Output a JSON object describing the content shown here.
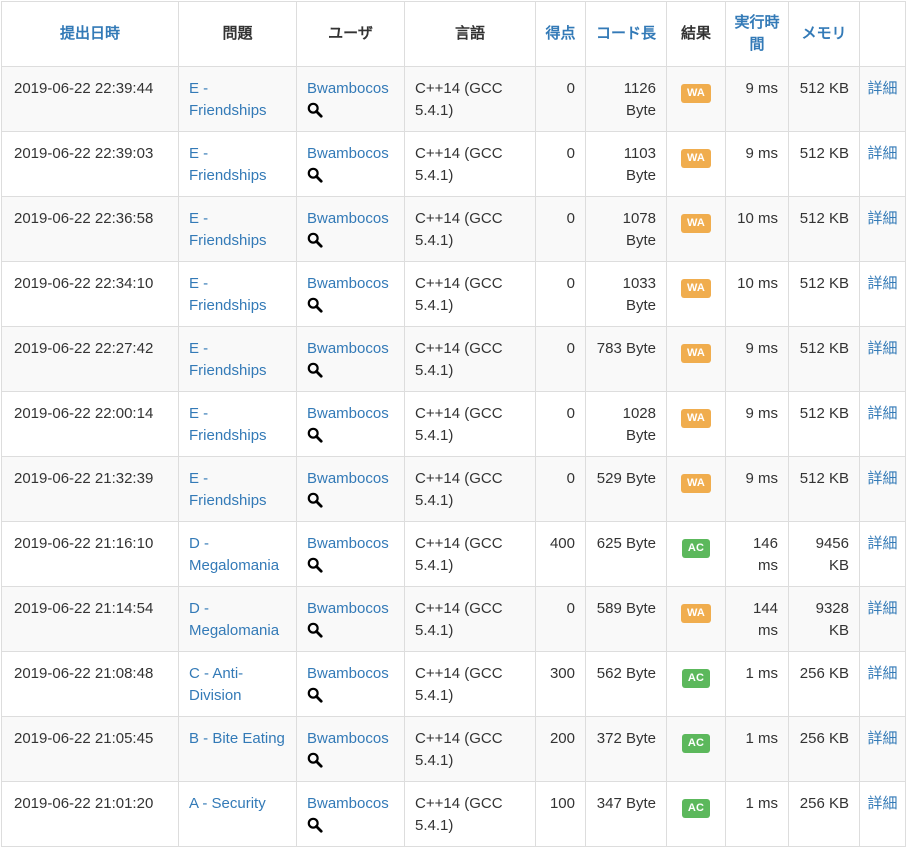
{
  "colors": {
    "link": "#337ab7",
    "wa": "#f0ad4e",
    "ac": "#5cb85c"
  },
  "headers": {
    "time": "提出日時",
    "problem": "問題",
    "user": "ユーザ",
    "language": "言語",
    "score": "得点",
    "code_length": "コード長",
    "result": "結果",
    "exec_time": "実行時間",
    "memory": "メモリ"
  },
  "icons": {
    "search": "magnifier-icon"
  },
  "rows": [
    {
      "time": "2019-06-22 22:39:44",
      "problem": "E - Friendships",
      "user": "Bwambocos",
      "lang": "C++14 (GCC 5.4.1)",
      "score": "0",
      "length": "1126 Byte",
      "result": "WA",
      "exec": "9 ms",
      "memory": "512 KB",
      "detail": "詳細"
    },
    {
      "time": "2019-06-22 22:39:03",
      "problem": "E - Friendships",
      "user": "Bwambocos",
      "lang": "C++14 (GCC 5.4.1)",
      "score": "0",
      "length": "1103 Byte",
      "result": "WA",
      "exec": "9 ms",
      "memory": "512 KB",
      "detail": "詳細"
    },
    {
      "time": "2019-06-22 22:36:58",
      "problem": "E - Friendships",
      "user": "Bwambocos",
      "lang": "C++14 (GCC 5.4.1)",
      "score": "0",
      "length": "1078 Byte",
      "result": "WA",
      "exec": "10 ms",
      "memory": "512 KB",
      "detail": "詳細"
    },
    {
      "time": "2019-06-22 22:34:10",
      "problem": "E - Friendships",
      "user": "Bwambocos",
      "lang": "C++14 (GCC 5.4.1)",
      "score": "0",
      "length": "1033 Byte",
      "result": "WA",
      "exec": "10 ms",
      "memory": "512 KB",
      "detail": "詳細"
    },
    {
      "time": "2019-06-22 22:27:42",
      "problem": "E - Friendships",
      "user": "Bwambocos",
      "lang": "C++14 (GCC 5.4.1)",
      "score": "0",
      "length": "783 Byte",
      "result": "WA",
      "exec": "9 ms",
      "memory": "512 KB",
      "detail": "詳細"
    },
    {
      "time": "2019-06-22 22:00:14",
      "problem": "E - Friendships",
      "user": "Bwambocos",
      "lang": "C++14 (GCC 5.4.1)",
      "score": "0",
      "length": "1028 Byte",
      "result": "WA",
      "exec": "9 ms",
      "memory": "512 KB",
      "detail": "詳細"
    },
    {
      "time": "2019-06-22 21:32:39",
      "problem": "E - Friendships",
      "user": "Bwambocos",
      "lang": "C++14 (GCC 5.4.1)",
      "score": "0",
      "length": "529 Byte",
      "result": "WA",
      "exec": "9 ms",
      "memory": "512 KB",
      "detail": "詳細"
    },
    {
      "time": "2019-06-22 21:16:10",
      "problem": "D - Megalomania",
      "user": "Bwambocos",
      "lang": "C++14 (GCC 5.4.1)",
      "score": "400",
      "length": "625 Byte",
      "result": "AC",
      "exec": "146 ms",
      "memory": "9456 KB",
      "detail": "詳細"
    },
    {
      "time": "2019-06-22 21:14:54",
      "problem": "D - Megalomania",
      "user": "Bwambocos",
      "lang": "C++14 (GCC 5.4.1)",
      "score": "0",
      "length": "589 Byte",
      "result": "WA",
      "exec": "144 ms",
      "memory": "9328 KB",
      "detail": "詳細"
    },
    {
      "time": "2019-06-22 21:08:48",
      "problem": "C - Anti-Division",
      "user": "Bwambocos",
      "lang": "C++14 (GCC 5.4.1)",
      "score": "300",
      "length": "562 Byte",
      "result": "AC",
      "exec": "1 ms",
      "memory": "256 KB",
      "detail": "詳細"
    },
    {
      "time": "2019-06-22 21:05:45",
      "problem": "B - Bite Eating",
      "user": "Bwambocos",
      "lang": "C++14 (GCC 5.4.1)",
      "score": "200",
      "length": "372 Byte",
      "result": "AC",
      "exec": "1 ms",
      "memory": "256 KB",
      "detail": "詳細"
    },
    {
      "time": "2019-06-22 21:01:20",
      "problem": "A - Security",
      "user": "Bwambocos",
      "lang": "C++14 (GCC 5.4.1)",
      "score": "100",
      "length": "347 Byte",
      "result": "AC",
      "exec": "1 ms",
      "memory": "256 KB",
      "detail": "詳細"
    }
  ]
}
